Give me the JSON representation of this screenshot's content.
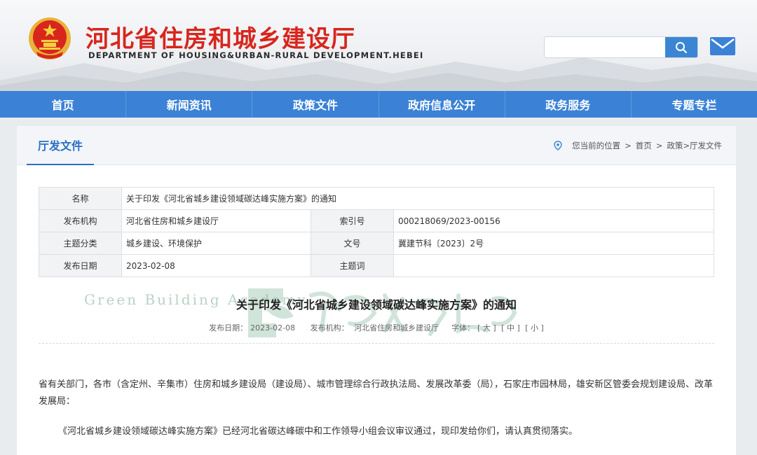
{
  "header": {
    "title": "河北省住房和城乡建设厅",
    "subtitle": "DEPARTMENT OF HOUSING&URBAN-RURAL DEVELOPMENT.HEBEI",
    "search_placeholder": "",
    "search_value": ""
  },
  "nav": {
    "items": [
      "首页",
      "新闻资讯",
      "政策文件",
      "政府信息公开",
      "政务服务",
      "专题专栏"
    ]
  },
  "section": {
    "tab_label": "厅发文件",
    "breadcrumb_prefix": "您当前的位置",
    "breadcrumb_home": "首页",
    "breadcrumb_sep": ">",
    "breadcrumb_path": "政策>厅发文件"
  },
  "info": {
    "name_label": "名称",
    "name_value": "关于印发《河北省城乡建设领域碳达峰实施方案》的通知",
    "issuer_label": "发布机构",
    "issuer_value": "河北省住房和城乡建设厅",
    "index_label": "索引号",
    "index_value": "000218069/2023-00156",
    "topic_label": "主题分类",
    "topic_value": "城乡建设、环境保护",
    "docno_label": "文号",
    "docno_value": "冀建节科〔2023〕2号",
    "date_label": "发布日期",
    "date_value": "2023-02-08",
    "keyword_label": "主题词",
    "keyword_value": ""
  },
  "article": {
    "title": "关于印发《河北省城乡建设领域碳达峰实施方案》的通知",
    "meta_date_label": "发布日期：",
    "meta_date": "2023-02-08",
    "meta_org_label": "发布机构：",
    "meta_org": "河北省住房和城乡建设厅",
    "meta_font_label": "字体：",
    "font_large": "[ 大 ]",
    "font_medium": "[ 中 ]",
    "font_small": "[ 小 ]",
    "para1": "省有关部门，各市（含定州、辛集市）住房和城乡建设局（建设局）、城市管理综合行政执法局、发展改革委（局），石家庄市园林局，雄安新区管委会规划建设局、改革发展局：",
    "para2": "《河北省城乡建设领域碳达峰实施方案》已经河北省碳达峰碳中和工作领导小组会议审议通过，现印发给你们，请认真贯彻落实。"
  },
  "watermark": {
    "text": "Green Building Academy"
  },
  "colors": {
    "title_red": "#d8261d",
    "nav_blue": "#3b82d6",
    "accent_blue": "#2b6fc6"
  }
}
